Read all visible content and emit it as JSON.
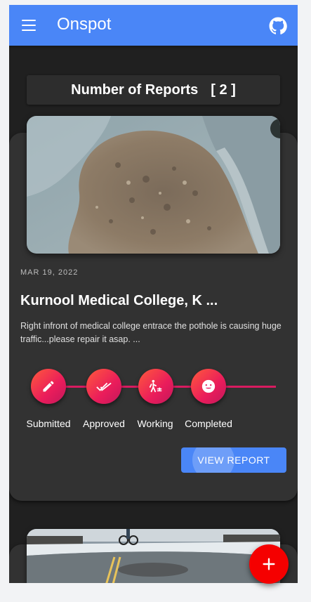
{
  "app": {
    "title": "Onspot"
  },
  "reports": {
    "label": "Number of Reports",
    "count": "[ 2 ]"
  },
  "report_card": {
    "date": "MAR 19, 2022",
    "place": "Kurnool Medical College, K ...",
    "description": "Right infront of medical college entrace the pothole is causing huge traffic...please repair it asap. ...",
    "steps": [
      {
        "label": "Submitted",
        "icon": "pencil-icon"
      },
      {
        "label": "Approved",
        "icon": "double-check-icon"
      },
      {
        "label": "Working",
        "icon": "worker-icon"
      },
      {
        "label": "Completed",
        "icon": "smile-icon"
      }
    ],
    "view_button": "VIEW REPORT"
  },
  "colors": {
    "accent": "#4a86f7",
    "fab": "#f50000",
    "step_gradient_start": "#ff5a3c",
    "step_gradient_end": "#c2185b",
    "background": "#202020",
    "card": "#323232"
  },
  "icons": {
    "menu": "menu-icon",
    "github": "github-icon",
    "fab": "plus-icon"
  }
}
